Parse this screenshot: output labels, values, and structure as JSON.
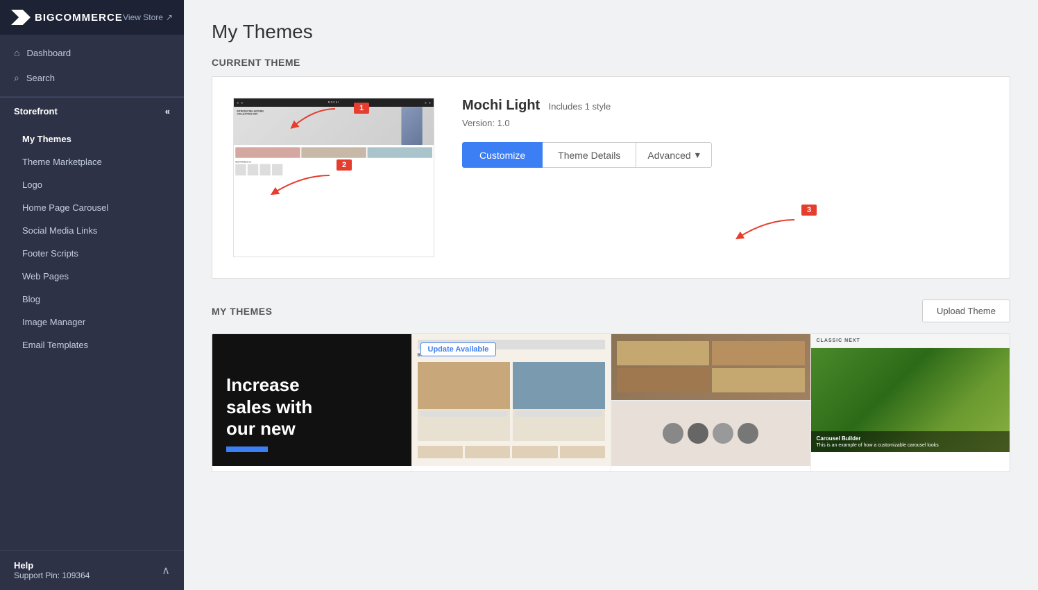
{
  "sidebar": {
    "logo": "BIGCOMMERCE",
    "view_store": "View Store",
    "nav": {
      "dashboard": "Dashboard",
      "search": "Search"
    },
    "storefront_label": "Storefront",
    "storefront_items": [
      {
        "label": "My Themes",
        "active": true
      },
      {
        "label": "Theme Marketplace"
      },
      {
        "label": "Logo"
      },
      {
        "label": "Home Page Carousel"
      },
      {
        "label": "Social Media Links"
      },
      {
        "label": "Footer Scripts"
      },
      {
        "label": "Web Pages"
      },
      {
        "label": "Blog"
      },
      {
        "label": "Image Manager"
      },
      {
        "label": "Email Templates"
      }
    ],
    "footer": {
      "help": "Help",
      "support": "Support Pin: 109364"
    }
  },
  "page": {
    "title": "My Themes",
    "current_theme_label": "Current Theme",
    "my_themes_label": "My Themes"
  },
  "current_theme": {
    "name": "Mochi Light",
    "subtitle": "Includes 1 style",
    "version": "Version: 1.0",
    "btn_customize": "Customize",
    "btn_theme_details": "Theme Details",
    "btn_advanced": "Advanced"
  },
  "my_themes": {
    "btn_upload": "Upload Theme",
    "promo": {
      "line1": "Increase",
      "line2": "sales with",
      "line3": "our new"
    },
    "update_badge": "Update Available",
    "classic_next": "CLASSIC NEXT",
    "classic_next_desc": "This is an example of how a customizable carousel looks"
  },
  "annotations": {
    "badge1": "1",
    "badge2": "2",
    "badge3": "3"
  }
}
